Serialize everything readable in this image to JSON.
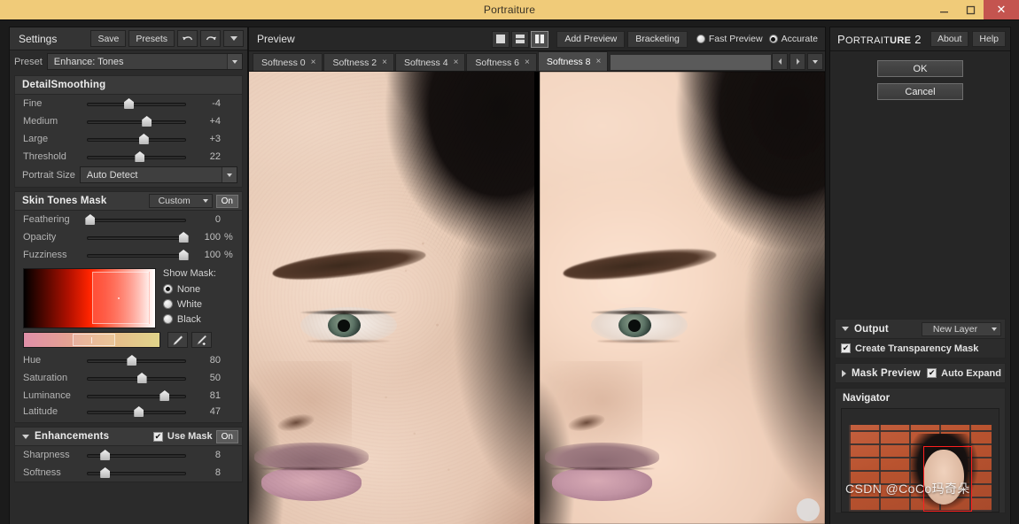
{
  "window": {
    "title": "Portraiture",
    "minimize_label": "minimize",
    "maximize_label": "maximize",
    "close_label": "✕"
  },
  "settings_panel": {
    "header_title": "Settings",
    "save_label": "Save",
    "presets_label": "Presets",
    "undo_icon": "undo-icon",
    "redo_icon": "redo-icon",
    "menu_icon": "chevron-down-icon",
    "preset_label": "Preset",
    "preset_value": "Enhance: Tones",
    "detail_smoothing": {
      "title": "DetailSmoothing",
      "sliders": [
        {
          "label": "Fine",
          "value": "-4",
          "pos": 42
        },
        {
          "label": "Medium",
          "value": "+4",
          "pos": 60
        },
        {
          "label": "Large",
          "value": "+3",
          "pos": 57
        },
        {
          "label": "Threshold",
          "value": "22",
          "pos": 53
        }
      ],
      "portrait_size_label": "Portrait Size",
      "portrait_size_value": "Auto Detect"
    },
    "skin_tones_mask": {
      "title": "Skin Tones Mask",
      "mode_value": "Custom",
      "toggle_label": "On",
      "sliders": [
        {
          "label": "Feathering",
          "value": "0",
          "unit": "",
          "pos": 3
        },
        {
          "label": "Opacity",
          "value": "100",
          "unit": "%",
          "pos": 97
        },
        {
          "label": "Fuzziness",
          "value": "100",
          "unit": "%",
          "pos": 97
        }
      ],
      "show_mask_label": "Show Mask:",
      "show_mask_options": [
        {
          "label": "None",
          "selected": true
        },
        {
          "label": "White",
          "selected": false
        },
        {
          "label": "Black",
          "selected": false
        }
      ],
      "eyedropper_icon": "eyedropper-icon",
      "eyedropper_add_icon": "eyedropper-add-icon",
      "tone_sliders": [
        {
          "label": "Hue",
          "value": "80",
          "pos": 45
        },
        {
          "label": "Saturation",
          "value": "50",
          "pos": 55
        },
        {
          "label": "Luminance",
          "value": "81",
          "pos": 78
        },
        {
          "label": "Latitude",
          "value": "47",
          "pos": 52
        }
      ]
    },
    "enhancements": {
      "title": "Enhancements",
      "use_mask_label": "Use Mask",
      "use_mask_checked": true,
      "toggle_label": "On",
      "sliders": [
        {
          "label": "Sharpness",
          "value": "8",
          "pos": 18
        },
        {
          "label": "Softness",
          "value": "8",
          "pos": 18
        }
      ]
    }
  },
  "preview_panel": {
    "header_title": "Preview",
    "view_modes": [
      {
        "icon": "single-view-icon",
        "active": false
      },
      {
        "icon": "split-horizontal-view-icon",
        "active": false
      },
      {
        "icon": "split-vertical-view-icon",
        "active": true
      }
    ],
    "add_preview_label": "Add Preview",
    "bracketing_label": "Bracketing",
    "quality_options": [
      {
        "label": "Fast Preview",
        "selected": false
      },
      {
        "label": "Accurate",
        "selected": true
      }
    ],
    "tabs": [
      {
        "label": "Softness 0",
        "close": "×",
        "active": false
      },
      {
        "label": "Softness 2",
        "close": "×",
        "active": false
      },
      {
        "label": "Softness 4",
        "close": "×",
        "active": false
      },
      {
        "label": "Softness 6",
        "close": "×",
        "active": false
      },
      {
        "label": "Softness 8",
        "close": "×",
        "active": true
      }
    ],
    "tab_nav": {
      "prev_icon": "arrow-left-icon",
      "next_icon": "arrow-right-icon",
      "list_icon": "chevron-down-icon"
    },
    "images": [
      {
        "name": "original-preview-image",
        "smoothed": false
      },
      {
        "name": "processed-preview-image",
        "smoothed": true
      }
    ]
  },
  "right_panel": {
    "brand_prefix": "P",
    "brand_mid": "ORTRAIT",
    "brand_bold": "URE",
    "brand_version": "2",
    "about_label": "About",
    "help_label": "Help",
    "ok_label": "OK",
    "cancel_label": "Cancel",
    "output": {
      "title": "Output",
      "mode_value": "New Layer",
      "transparency_label": "Create Transparency Mask",
      "transparency_checked": true
    },
    "mask_preview": {
      "title": "Mask Preview",
      "auto_expand_label": "Auto Expand",
      "auto_expand_checked": true
    },
    "navigator": {
      "title": "Navigator",
      "watermark": "CSDN @CoCo玛奇朵"
    }
  },
  "colors": {
    "titlebar": "#f0cb79",
    "close_button": "#c4544f",
    "panel_bg": "#2b2b2b",
    "selection_rect": "#ff1f1f"
  }
}
